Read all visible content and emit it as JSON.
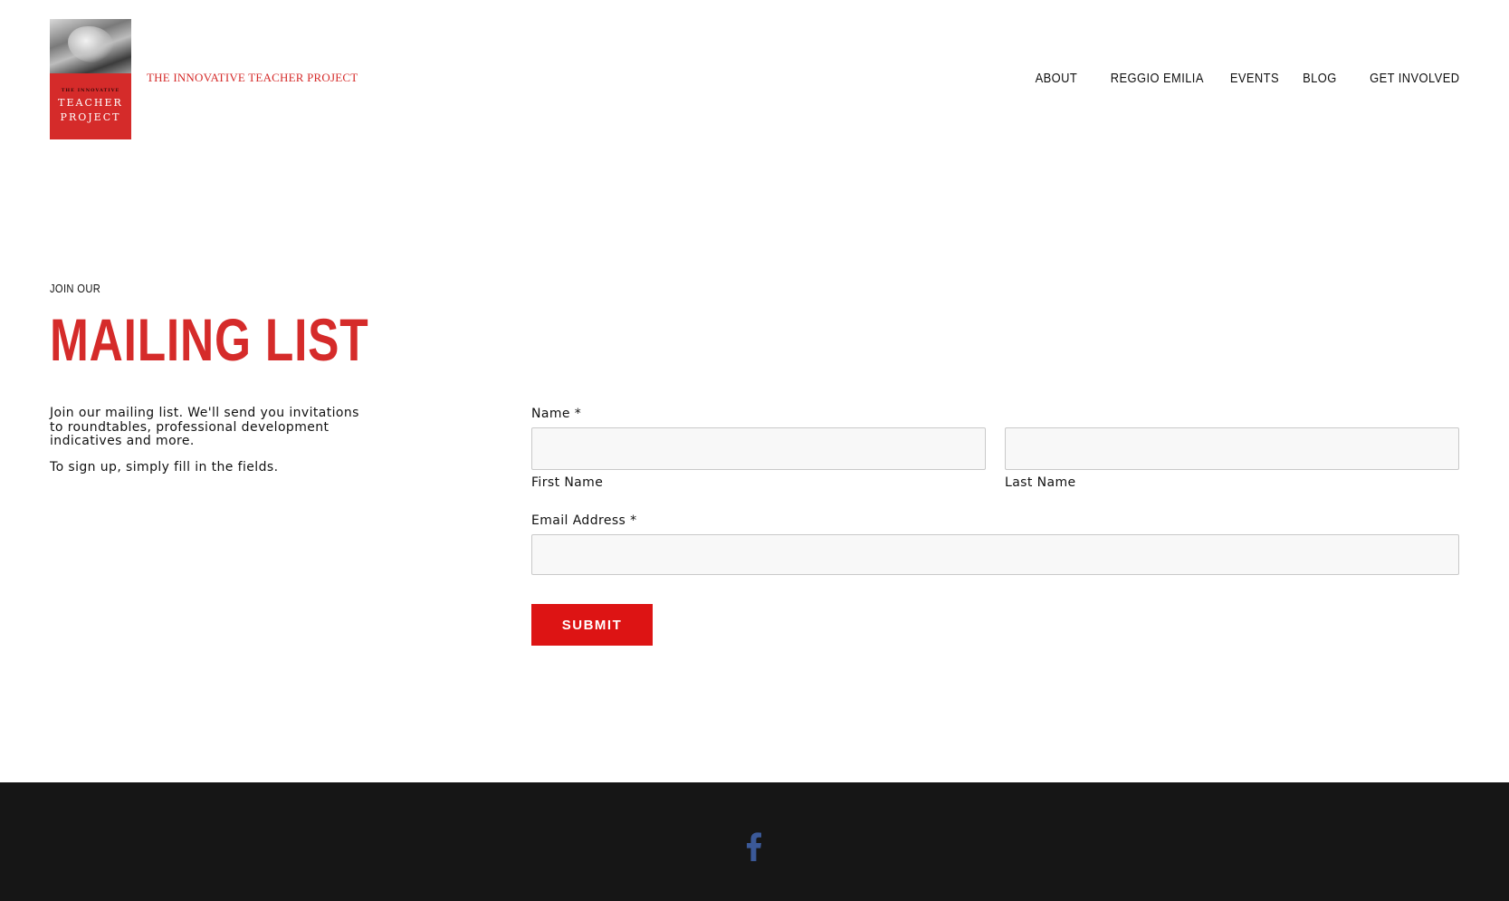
{
  "header": {
    "logo": {
      "small_text": "THE INNOVATIVE",
      "line1": "TEACHER",
      "line2": "PROJECT"
    },
    "site_title": "THE INNOVATIVE TEACHER PROJECT",
    "nav": [
      "ABOUT",
      "REGGIO EMILIA",
      "EVENTS",
      "BLOG",
      "GET INVOLVED"
    ]
  },
  "heading": {
    "eyebrow": "JOIN OUR",
    "title": "MAILING LIST"
  },
  "intro": {
    "paragraph1": "Join our mailing list. We'll send you invitations to roundtables, professional development indicatives and more.",
    "paragraph2": "To sign up, simply fill in the fields."
  },
  "form": {
    "name_label": "Name *",
    "first_name_sublabel": "First Name",
    "last_name_sublabel": "Last Name",
    "first_name_value": "",
    "last_name_value": "",
    "email_label": "Email Address *",
    "email_value": "",
    "submit_label": "SUBMIT"
  },
  "footer": {
    "social_icon": "facebook-icon",
    "icon_color": "#3b5998"
  },
  "colors": {
    "accent": "#d52b2a",
    "button": "#dd1414",
    "footer_bg": "#161616"
  }
}
